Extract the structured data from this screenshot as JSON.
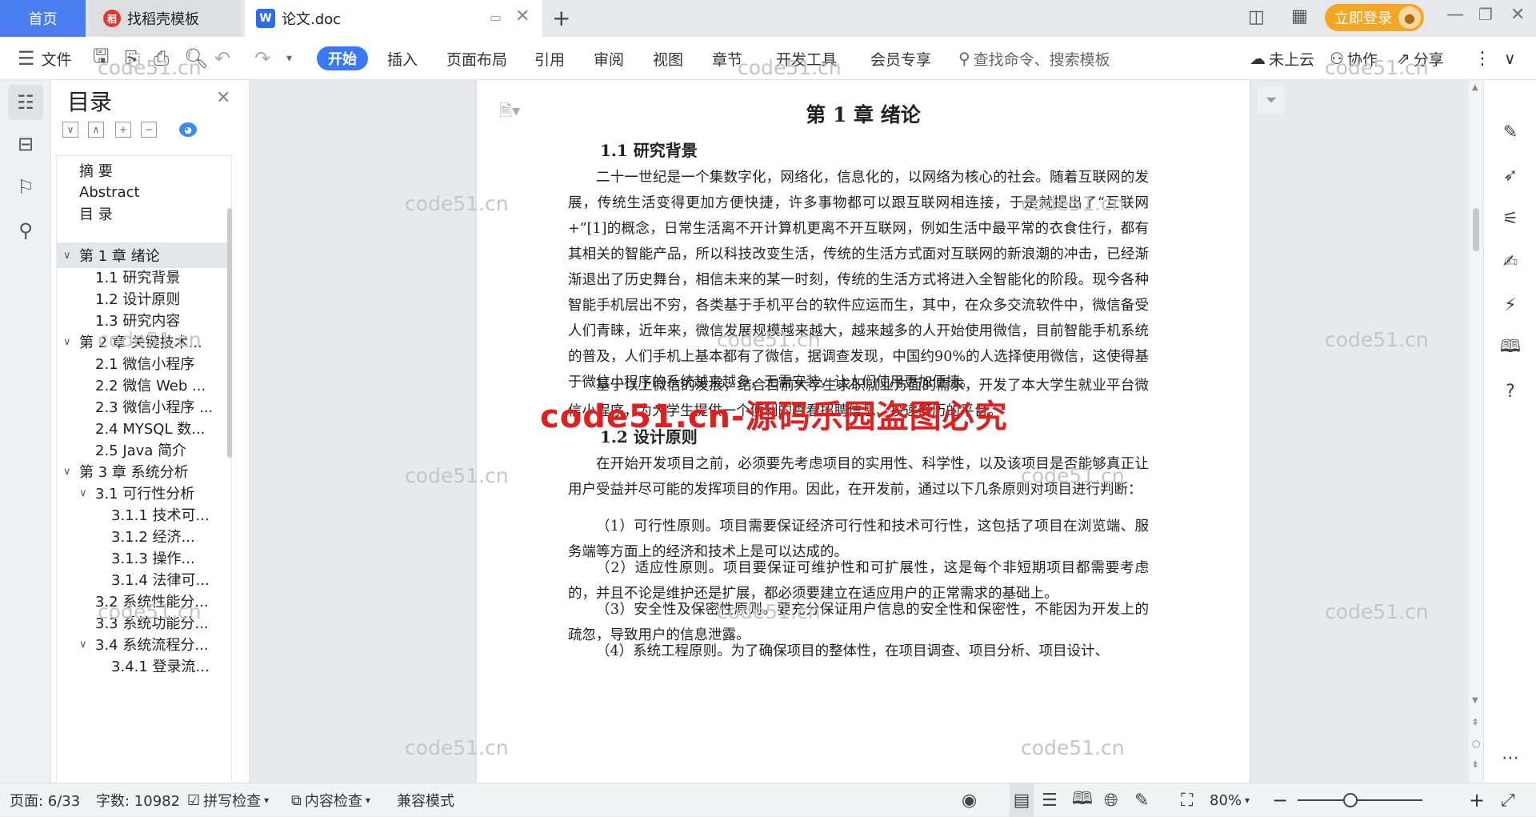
{
  "tabs": {
    "home": "首页",
    "template": "找稻壳模板",
    "document": "论文.doc",
    "login": "立即登录"
  },
  "toolbar": {
    "file": "文件",
    "menus": [
      "开始",
      "插入",
      "页面布局",
      "引用",
      "审阅",
      "视图",
      "章节",
      "开发工具",
      "会员专享"
    ],
    "search_placeholder": "查找命令、搜索模板",
    "cloud": "未上云",
    "collab": "协作",
    "share": "分享"
  },
  "toc": {
    "title": "目录",
    "items": [
      {
        "label": "摘  要",
        "level": 0,
        "arrow": ""
      },
      {
        "label": "Abstract",
        "level": 0,
        "arrow": ""
      },
      {
        "label": "目    录",
        "level": 0,
        "arrow": ""
      },
      {
        "label": "第 1 章   绪论",
        "level": 0,
        "arrow": "∨",
        "selected": true
      },
      {
        "label": "1.1 研究背景",
        "level": 1,
        "arrow": ""
      },
      {
        "label": "1.2 设计原则",
        "level": 1,
        "arrow": ""
      },
      {
        "label": "1.3 研究内容",
        "level": 1,
        "arrow": ""
      },
      {
        "label": "第 2 章   关键技术...",
        "level": 0,
        "arrow": "∨"
      },
      {
        "label": "2.1  微信小程序",
        "level": 1,
        "arrow": ""
      },
      {
        "label": "2.2 微信 Web  ...",
        "level": 1,
        "arrow": ""
      },
      {
        "label": "2.3 微信小程序 ...",
        "level": 1,
        "arrow": ""
      },
      {
        "label": "2.4 MYSQL 数...",
        "level": 1,
        "arrow": ""
      },
      {
        "label": "2.5 Java 简介",
        "level": 1,
        "arrow": ""
      },
      {
        "label": "第 3 章   系统分析",
        "level": 0,
        "arrow": "∨"
      },
      {
        "label": "3.1  可行性分析",
        "level": 1,
        "arrow": "∨"
      },
      {
        "label": "3.1.1 技术可...",
        "level": 2,
        "arrow": ""
      },
      {
        "label": "3.1.2  经济...",
        "level": 2,
        "arrow": ""
      },
      {
        "label": "3.1.3  操作...",
        "level": 2,
        "arrow": ""
      },
      {
        "label": "3.1.4 法律可...",
        "level": 2,
        "arrow": ""
      },
      {
        "label": "3.2  系统性能分...",
        "level": 1,
        "arrow": ""
      },
      {
        "label": "3.3  系统功能分...",
        "level": 1,
        "arrow": ""
      },
      {
        "label": "3.4  系统流程分...",
        "level": 1,
        "arrow": "∨"
      },
      {
        "label": "3.4.1 登录流...",
        "level": 2,
        "arrow": ""
      }
    ]
  },
  "document": {
    "chapter": "第 1 章    绪论",
    "sec1": "1.1 研究背景",
    "p1": "二十一世纪是一个集数字化，网络化，信息化的，以网络为核心的社会。随着互联网的发展，传统生活变得更加方便快捷，许多事物都可以跟互联网相连接，于是就提出了“互联网+”[1]的概念，日常生活离不开计算机更离不开互联网，例如生活中最平常的衣食住行，都有其相关的智能产品，所以科技改变生活，传统的生活方式面对互联网的新浪潮的冲击，已经渐渐退出了历史舞台，相信未来的某一时刻，传统的生活方式将进入全智能化的阶段。现今各种智能手机层出不穷，各类基于手机平台的软件应运而生，其中，在众多交流软件中，微信备受人们青睐，近年来，微信发展规模越来越大，越来越多的人开始使用微信，目前智能手机系统的普及，人们手机上基本都有了微信，据调查发现，中国约90%的人选择使用微信，这使得基于微信小程序的系统越来越多，无需安装，让人们使用更加便捷。",
    "p2": "基于以上微信的发展，结合目前大学生求职就业方面的需求，开发了本大学生就业平台微信小程序，为大学生提供一个便利的查看招聘信息、投递简历的平台。",
    "sec2": "1.2 设计原则",
    "p3": "在开始开发项目之前，必须要先考虑项目的实用性、科学性，以及该项目是否能够真正让用户受益并尽可能的发挥项目的作用。因此，在开发前，通过以下几条原则对项目进行判断：",
    "p4": "（1）可行性原则。项目需要保证经济可行性和技术可行性，这包括了项目在浏览端、服务端等方面上的经济和技术上是可以达成的。",
    "p5": "（2）适应性原则。项目要保证可维护性和可扩展性，这是每个非短期项目都需要考虑的，并且不论是维护还是扩展，都必须要建立在适应用户的正常需求的基础上。",
    "p6": "（3）安全性及保密性原则。要充分保证用户信息的安全性和保密性，不能因为开发上的疏忽，导致用户的信息泄露。",
    "p7": "（4）系统工程原则。为了确保项目的整体性，在项目调查、项目分析、项目设计、"
  },
  "watermark": {
    "text": "code51.cn",
    "red": "code51.cn-源码乐园盗图必究"
  },
  "status": {
    "page": "页面: 6/33",
    "words": "字数: 10982",
    "spell": "拼写检查",
    "content": "内容检查",
    "compat": "兼容模式",
    "zoom": "80%",
    "zoom_level": 0.42
  },
  "colors": {
    "accent": "#3a79f5",
    "login": "#f5a623",
    "watermark_red": "#e02020"
  }
}
